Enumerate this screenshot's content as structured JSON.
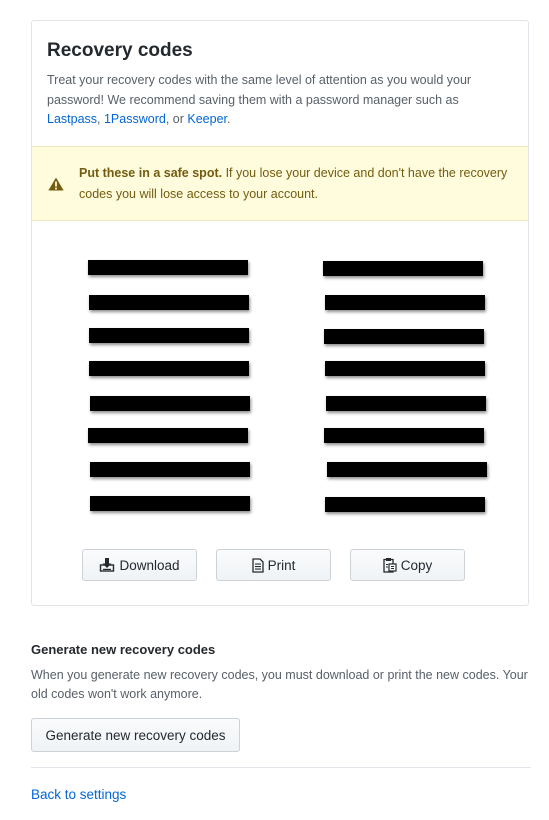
{
  "card": {
    "title": "Recovery codes",
    "intro_text": "Treat your recovery codes with the same level of attention as you would your password! We recommend saving them with a password manager such as",
    "links": [
      "Lastpass",
      "1Password",
      "Keeper"
    ],
    "sep_comma": ", ",
    "sep_or": ", or ",
    "end_period": "."
  },
  "warning": {
    "strong": "Put these in a safe spot.",
    "text": " If you lose your device and don't have the recovery codes you will lose access to your account."
  },
  "actions": {
    "download": "Download",
    "print": "Print",
    "copy": "Copy"
  },
  "generate": {
    "heading": "Generate new recovery codes",
    "description": "When you generate new recovery codes, you must download or print the new codes. Your old codes won't work anymore.",
    "button": "Generate new recovery codes"
  },
  "footer": {
    "back_link": "Back to settings"
  },
  "colors": {
    "link": "#0366d6",
    "warning_bg": "#fffbdd",
    "warning_text": "#735c0f"
  },
  "icons": [
    "alert-icon",
    "download-icon",
    "file-icon",
    "clippy-icon"
  ]
}
